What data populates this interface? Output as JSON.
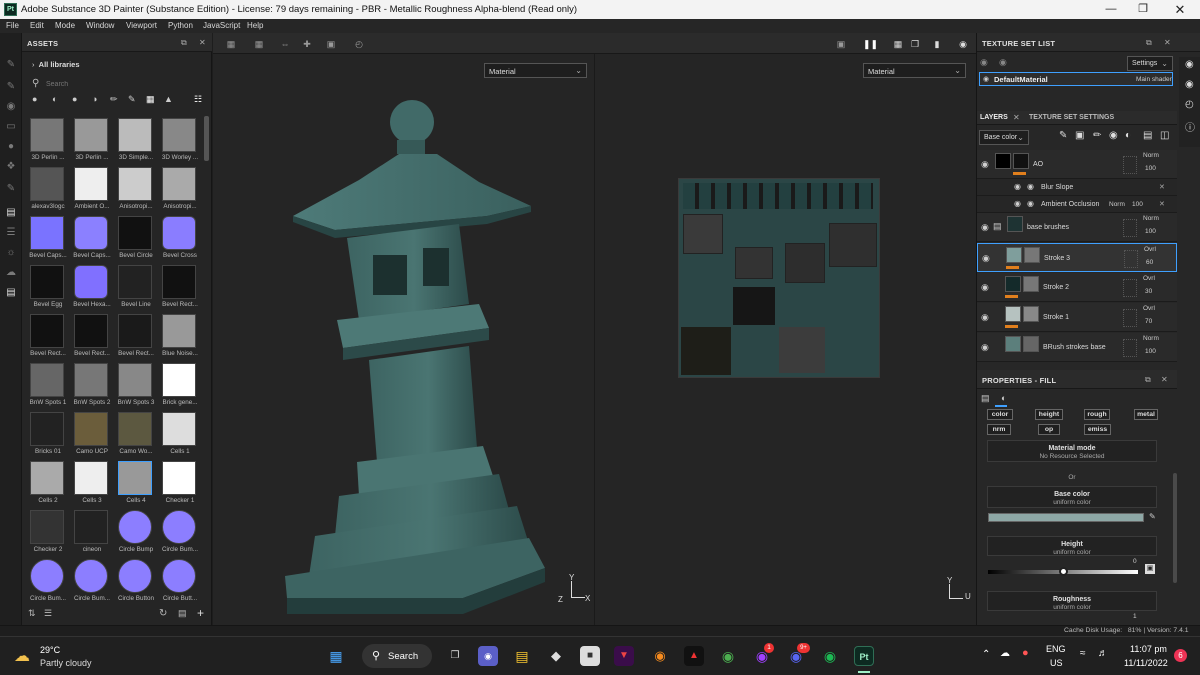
{
  "titlebar": {
    "title": "Adobe Substance 3D Painter (Substance Edition) - License: 79 days remaining - PBR - Metallic Roughness Alpha-blend (Read only)",
    "app_icon": "Pt"
  },
  "menu": [
    "File",
    "Edit",
    "Mode",
    "Window",
    "Viewport",
    "Python",
    "JavaScript",
    "Help"
  ],
  "assets": {
    "title": "ASSETS",
    "all_libraries": "All libraries",
    "search_placeholder": "Search",
    "items": [
      "3D Perlin ...",
      "3D Perlin ...",
      "3D Simple...",
      "3D Worley ...",
      "alexav3logc",
      "Ambient O...",
      "Anisotropi...",
      "Anisotropi...",
      "Bevel Caps...",
      "Bevel Caps...",
      "Bevel Circle",
      "Bevel Cross",
      "Bevel Egg",
      "Bevel Hexa...",
      "Bevel Line",
      "Bevel Rect...",
      "Bevel Rect...",
      "Bevel Rect...",
      "Bevel Rect...",
      "Blue Noise...",
      "BnW Spots 1",
      "BnW Spots 2",
      "BnW Spots 3",
      "Brick gene...",
      "Bricks 01",
      "Camo UCP",
      "Camo Wo...",
      "Cells 1",
      "Cells 2",
      "Cells 3",
      "Cells 4",
      "Checker 1",
      "Checker 2",
      "cineon",
      "Circle Bump",
      "Circle Bum...",
      "Circle Bum...",
      "Circle Bum...",
      "Circle Button",
      "Circle Butt..."
    ],
    "selected_item": "Cells 4"
  },
  "viewport": {
    "left_dropdown": "Material",
    "right_dropdown": "Material",
    "axis_x": "X",
    "axis_y": "Y",
    "axis_z": "Z",
    "axis_u": "U"
  },
  "texture_set_list": {
    "title": "TEXTURE SET LIST",
    "settings": "Settings",
    "material_name": "DefaultMaterial",
    "shader": "Main shader"
  },
  "layers_panel": {
    "tab_layers": "LAYERS",
    "tab_texture_settings": "TEXTURE SET SETTINGS",
    "channel_select": "Base color",
    "layers": [
      {
        "name": "AO",
        "blend": "Norm",
        "opacity": "100"
      },
      {
        "name": "Blur Slope"
      },
      {
        "name": "Ambient Occlusion",
        "blend": "Norm",
        "opacity": "100"
      },
      {
        "name": "base brushes",
        "blend": "Norm",
        "opacity": "100"
      },
      {
        "name": "Stroke 3",
        "blend": "Ovrl",
        "opacity": "60"
      },
      {
        "name": "Stroke 2",
        "blend": "Ovrl",
        "opacity": "30"
      },
      {
        "name": "Stroke 1",
        "blend": "Ovrl",
        "opacity": "70"
      },
      {
        "name": "BRush strokes base",
        "blend": "Norm",
        "opacity": "100"
      }
    ]
  },
  "properties": {
    "title": "PROPERTIES - FILL",
    "channels": [
      "color",
      "height",
      "rough",
      "metal",
      "nrm",
      "op",
      "emiss"
    ],
    "material_mode_title": "Material mode",
    "material_mode_sub": "No Resource Selected",
    "or": "Or",
    "base_color_title": "Base color",
    "base_color_sub": "uniform color",
    "base_color_hex": "#8ea8a6",
    "height_title": "Height",
    "height_sub": "uniform color",
    "height_value": "0",
    "height_slider_fraction": 0.5,
    "roughness_title": "Roughness",
    "roughness_sub": "uniform color",
    "roughness_value": "1"
  },
  "statusbar": {
    "text": "Cache Disk Usage:   81% | Version: 7.4.1"
  },
  "taskbar": {
    "temp": "29°C",
    "weather": "Partly cloudy",
    "search": "Search",
    "lang": "ENG",
    "region": "US",
    "time": "11:07 pm",
    "date": "11/11/2022",
    "notif_count": "6",
    "messenger_badge": "1",
    "discord_badge": "9+"
  }
}
